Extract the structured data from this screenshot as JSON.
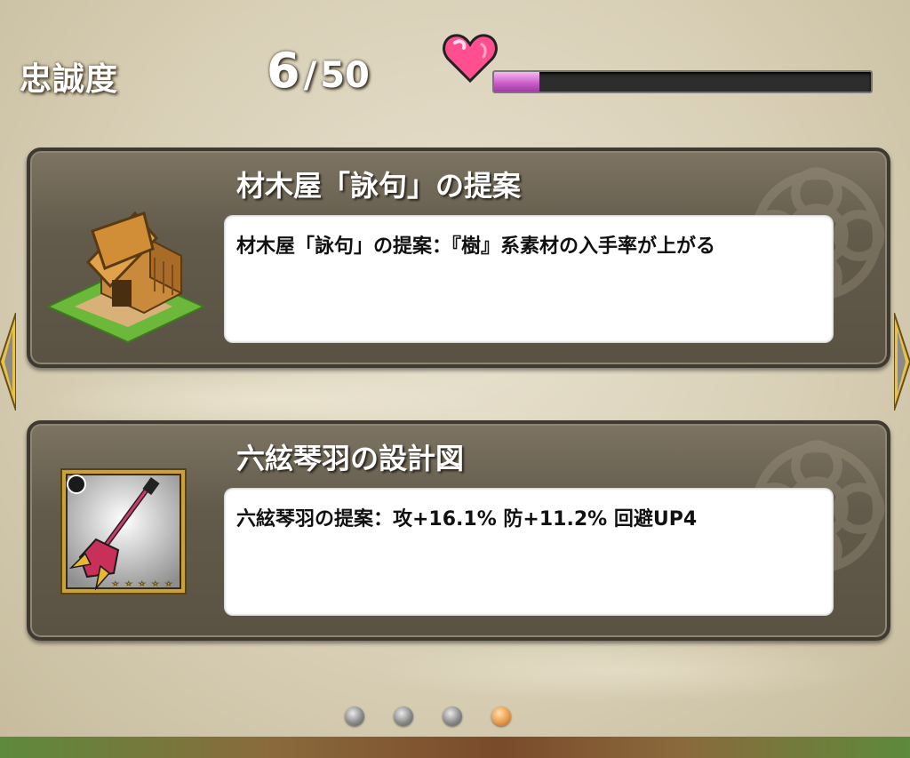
{
  "header": {
    "stat_label": "忠誠度",
    "current": "6",
    "separator": "/",
    "max": "50",
    "progress_fraction": 0.12,
    "bar_color": "#d86ad8",
    "heart_color": "#ff4f8f"
  },
  "cards": [
    {
      "title": "材木屋「詠句」の提案",
      "description": "材木屋「詠句」の提案：『樹』系素材の入手率が上がる",
      "icon": "lumber-house-icon"
    },
    {
      "title": "六絃琴羽の設計図",
      "description": "六絃琴羽の提案：攻+16.1% 防+11.2% 回避UP4",
      "icon": "guitar-weapon-icon",
      "stars": 5
    }
  ],
  "pager": {
    "total": 4,
    "active_index": 3,
    "active_color": "#e99b4a"
  }
}
